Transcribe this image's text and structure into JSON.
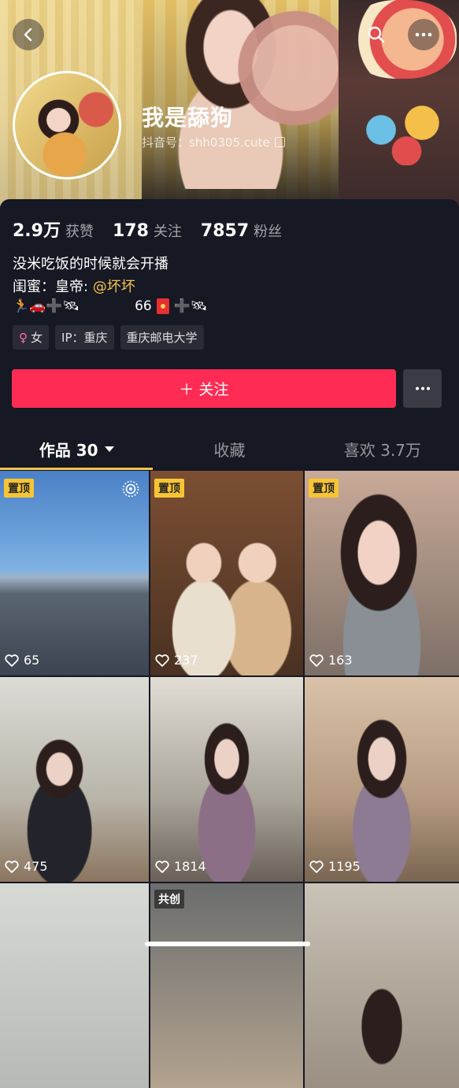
{
  "profile": {
    "nickname": "我是舔狗",
    "douyin_id": "抖音号：shh0305.cute"
  },
  "stats": {
    "likes_value": "2.9万",
    "likes_label": "获赞",
    "following_value": "178",
    "following_label": "关注",
    "followers_value": "7857",
    "followers_label": "粉丝"
  },
  "bio": {
    "line1": "没米吃饭的时候就会开播",
    "line2_prefix": "闺蜜：皇帝: ",
    "line2_mention": "@坏坏",
    "emoji_left": "🏃🚗➕🛰",
    "emoji_number": "66",
    "emoji_right": "➕🛰"
  },
  "tags": {
    "gender": "女",
    "ip": "IP：重庆",
    "school": "重庆邮电大学"
  },
  "actions": {
    "follow_label": "＋ 关注",
    "more_label": "···"
  },
  "tabs": {
    "works": "作品 30",
    "favorites": "收藏",
    "liked": "喜欢 3.7万"
  },
  "videos": [
    {
      "badge": "置顶",
      "likes": "65"
    },
    {
      "badge": "置顶",
      "likes": "237"
    },
    {
      "badge": "置顶",
      "likes": "163"
    },
    {
      "badge": "",
      "likes": "475"
    },
    {
      "badge": "",
      "likes": "1814"
    },
    {
      "badge": "",
      "likes": "1195"
    },
    {
      "badge": "",
      "likes": ""
    },
    {
      "badge": "共创",
      "likes": ""
    },
    {
      "badge": "",
      "likes": ""
    }
  ],
  "colors": {
    "follow_button": "#fe2c55",
    "pin_badge": "#f7c534",
    "mention": "#f7c34d",
    "background": "#161823"
  },
  "icons": [
    "back-icon",
    "search-icon",
    "more-icon",
    "copy-icon",
    "female-icon",
    "heart-icon",
    "target-icon",
    "caret-down-icon",
    "red-packet-icon"
  ]
}
